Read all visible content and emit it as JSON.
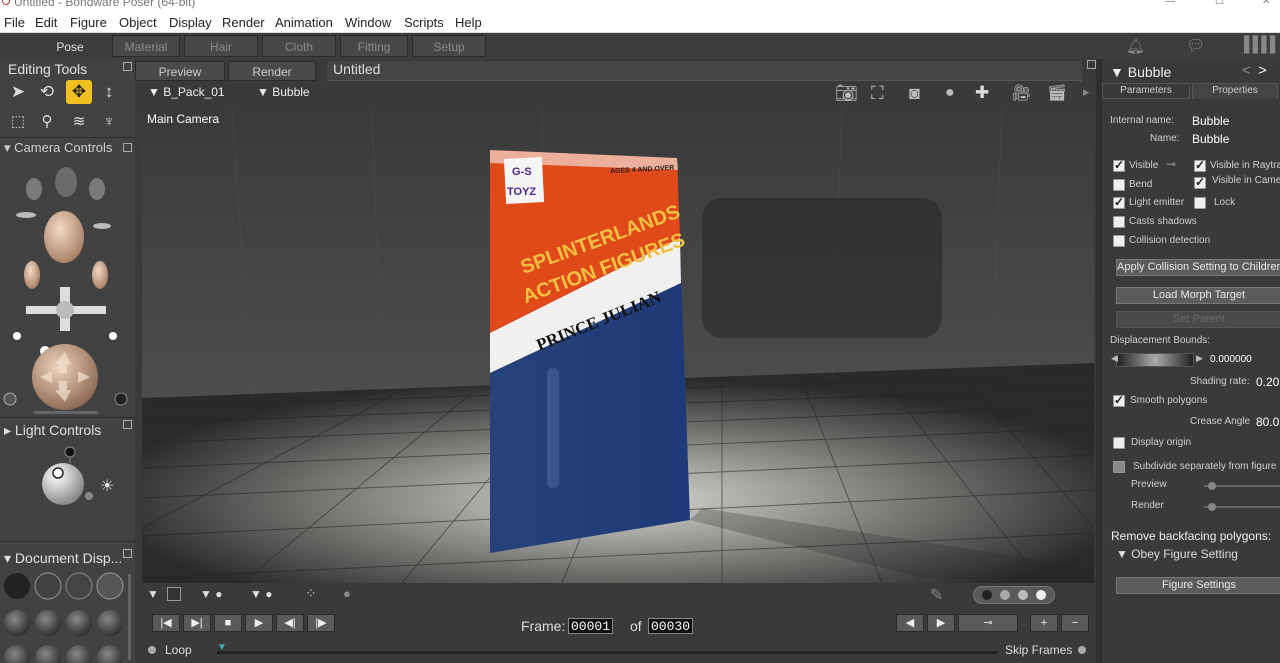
{
  "window": {
    "title": "Untitled - Bondware Poser (64-bit)"
  },
  "menu": [
    "File",
    "Edit",
    "Figure",
    "Object",
    "Display",
    "Render",
    "Animation",
    "Window",
    "Scripts",
    "Help"
  ],
  "rooms": [
    "Pose",
    "Material",
    "Hair",
    "Cloth",
    "Fitting",
    "Setup"
  ],
  "left": {
    "editing_tools": "Editing Tools",
    "camera_controls": "Camera Controls",
    "light_controls": "Light Controls",
    "document_display": "Document  Disp..."
  },
  "viewport": {
    "tabs": [
      "Preview",
      "Render"
    ],
    "doc_title": "Untitled",
    "figure_select": "B_Pack_01",
    "actor_select": "Bubble",
    "camera_label": "Main Camera",
    "package": {
      "brand": "G-S TOYZ",
      "ages": "AGES 4 AND OVER",
      "line1": "SPLINTERLANDS",
      "line2": "ACTION FIGURES",
      "name": "PRINCE JULIAN"
    }
  },
  "animation": {
    "frame_label": "Frame:",
    "frame_current": "00001",
    "of_label": "of",
    "frame_total": "00030",
    "loop_label": "Loop",
    "skip_frames_label": "Skip Frames"
  },
  "right": {
    "title": "Bubble",
    "tabs": [
      "Parameters",
      "Properties"
    ],
    "internal_name_label": "Internal name:",
    "internal_name": "Bubble",
    "name_label": "Name:",
    "name": "Bubble",
    "checks": [
      {
        "label": "Visible",
        "on": true
      },
      {
        "label": "Visible in Raytracing",
        "on": true
      },
      {
        "label": "Bend",
        "on": false
      },
      {
        "label": "Visible in Camera",
        "on": true
      },
      {
        "label": "Light emitter",
        "on": true
      },
      {
        "label": "Lock",
        "on": false
      },
      {
        "label": "Casts shadows",
        "on": false
      },
      {
        "label": "Collision detection",
        "on": false
      }
    ],
    "apply_collision_btn": "Apply Collision Setting to Children",
    "load_morph_btn": "Load Morph Target",
    "set_parent_btn": "Set Parent",
    "displacement_label": "Displacement Bounds:",
    "displacement_value": "0.000000",
    "shading_rate_label": "Shading rate:",
    "shading_rate_value": "0.20",
    "smooth_polygons_label": "Smooth polygons",
    "crease_angle_label": "Crease Angle",
    "crease_angle_value": "80.0",
    "display_origin_label": "Display origin",
    "subdivide_label": "Subdivide separately from figure",
    "preview_label": "Preview",
    "render_label": "Render",
    "remove_backfacing_label": "Remove backfacing polygons:",
    "obey_figure_label": "Obey Figure Setting",
    "figure_settings_btn": "Figure Settings"
  }
}
